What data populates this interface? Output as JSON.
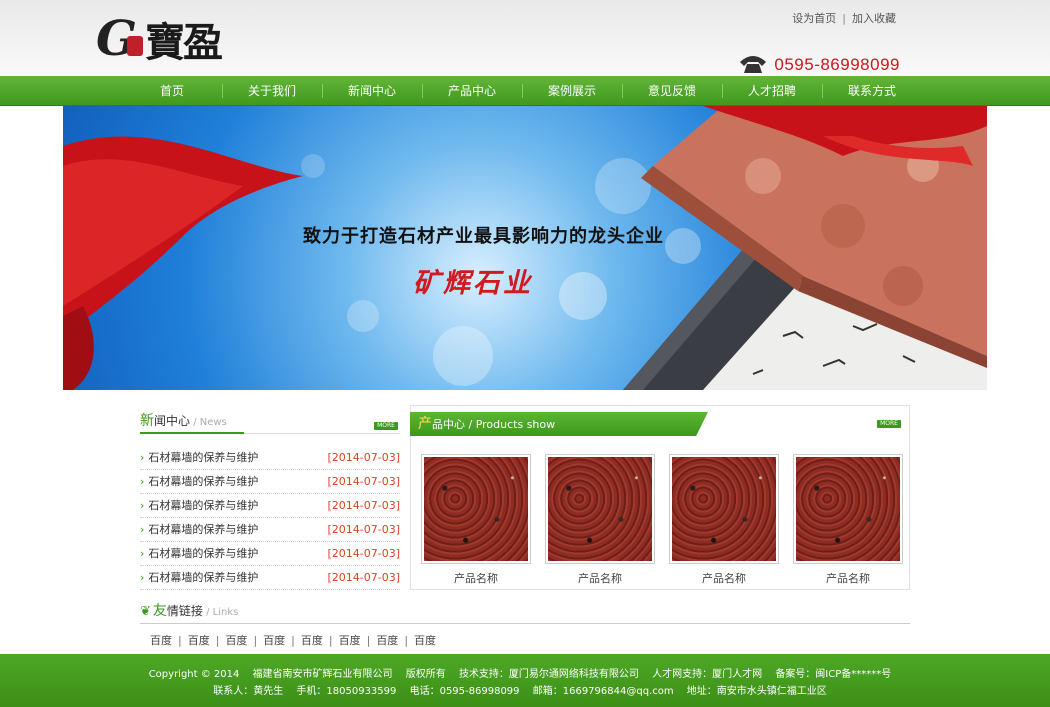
{
  "header": {
    "logo_letter": "G",
    "logo_text": "寶盈",
    "top_links": [
      "设为首页",
      "加入收藏"
    ],
    "top_link_separator": "|",
    "phone": "0595-86998099"
  },
  "nav": {
    "items": [
      "首页",
      "关于我们",
      "新闻中心",
      "产品中心",
      "案例展示",
      "意见反馈",
      "人才招聘",
      "联系方式"
    ]
  },
  "banner": {
    "title": "致力于打造石材产业最具影响力的龙头企业",
    "brand": "矿辉石业"
  },
  "news": {
    "title_first": "新",
    "title_rest": "闻中心",
    "title_en": " / News",
    "more": "MORE",
    "items": [
      {
        "title": "石材幕墙的保养与维护",
        "date": "[2014-07-03]"
      },
      {
        "title": "石材幕墙的保养与维护",
        "date": "[2014-07-03]"
      },
      {
        "title": "石材幕墙的保养与维护",
        "date": "[2014-07-03]"
      },
      {
        "title": "石材幕墙的保养与维护",
        "date": "[2014-07-03]"
      },
      {
        "title": "石材幕墙的保养与维护",
        "date": "[2014-07-03]"
      },
      {
        "title": "石材幕墙的保养与维护",
        "date": "[2014-07-03]"
      }
    ]
  },
  "products": {
    "title_first": "产",
    "title_rest": "品中心",
    "title_en": " / Products show",
    "more": "MORE",
    "items": [
      {
        "name": "产品名称"
      },
      {
        "name": "产品名称"
      },
      {
        "name": "产品名称"
      },
      {
        "name": "产品名称"
      }
    ]
  },
  "links": {
    "title_first": "友",
    "title_rest": "情链接",
    "title_en": " / Links",
    "items": [
      "百度",
      "百度",
      "百度",
      "百度",
      "百度",
      "百度",
      "百度",
      "百度"
    ]
  },
  "footer": {
    "line1": [
      "Copyright © 2014",
      "福建省南安市矿辉石业有限公司",
      "版权所有",
      "技术支持：厦门易尔通网络科技有限公司",
      "人才网支持：厦门人才网",
      "备案号：闽ICP备******号"
    ],
    "line2": [
      "联系人：黄先生",
      "手机：18050933599",
      "电话：0595-86998099",
      "邮箱：1669796844@qq.com",
      "地址：南安市水头镇仁福工业区"
    ]
  },
  "colors": {
    "brand_green": "#3f9a1c",
    "accent_red": "#d0161c",
    "date_red": "#e0402a"
  }
}
